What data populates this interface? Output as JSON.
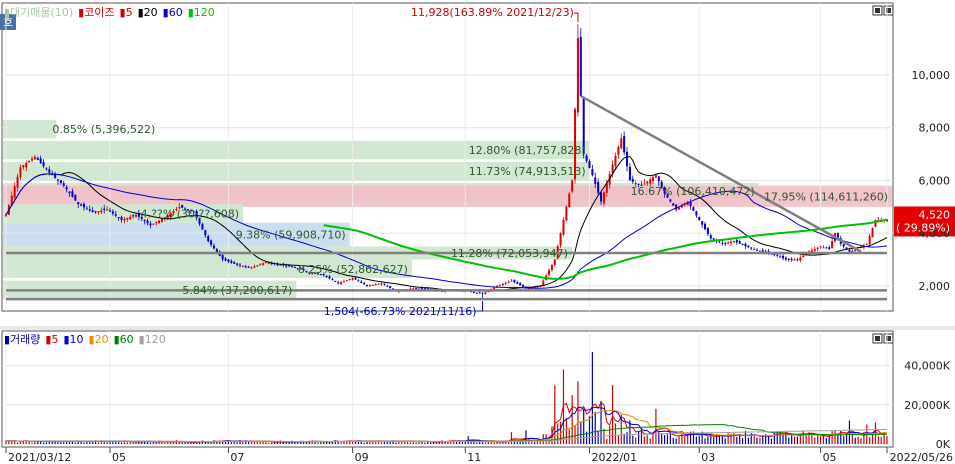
{
  "price_panel": {
    "legend": [
      {
        "text": "▮대기매물(10)",
        "color": "#a8c8a8"
      },
      {
        "text": "▮코이즈",
        "color": "#d40000"
      },
      {
        "text": "▮5",
        "color": "#d40000"
      },
      {
        "text": "▮20",
        "color": "#000000"
      },
      {
        "text": "▮60",
        "color": "#0000c8"
      },
      {
        "text": "▮120",
        "color": "#00c000"
      }
    ],
    "corner_tab": "호",
    "ylim": [
      1200,
      12200
    ],
    "y_ticks": [
      {
        "value": 2000,
        "label": "2,000"
      },
      {
        "value": 4000,
        "label": "4,000"
      },
      {
        "value": 6000,
        "label": "6,000"
      },
      {
        "value": 8000,
        "label": "8,000"
      },
      {
        "value": 10000,
        "label": "10,000"
      }
    ],
    "supply_bands": [
      {
        "low": 7600,
        "high": 8300,
        "width_frac": 0.06,
        "color": "#cfe6cf",
        "label": "0.85% (5,396,522)"
      },
      {
        "low": 6800,
        "high": 7500,
        "width_frac": 0.66,
        "color": "#cfe6cf",
        "label": "12.80% (81,757,828)"
      },
      {
        "low": 6000,
        "high": 6700,
        "width_frac": 0.66,
        "color": "#cfe6cf",
        "label": "11.73% (74,913,513)"
      },
      {
        "low": 5300,
        "high": 5900,
        "width_frac": 0.85,
        "color": "#cfe6cf",
        "label": "16.67% (106,410,472)"
      },
      {
        "low": 5000,
        "high": 5800,
        "width_frac": 1.0,
        "color": "#f0c0c8",
        "label": "17.95% (114,611,260)"
      },
      {
        "low": 4400,
        "high": 5100,
        "width_frac": 0.27,
        "color": "#cfe6cf",
        "label": "4.??% (30,??,608)"
      },
      {
        "low": 3500,
        "high": 4400,
        "width_frac": 0.39,
        "color": "#c8dcee",
        "label": "9.38% (59,908,710)"
      },
      {
        "low": 3000,
        "high": 3500,
        "width_frac": 0.64,
        "color": "#cfe6cf",
        "label": "11.28% (72,053,947)"
      },
      {
        "low": 2300,
        "high": 3000,
        "width_frac": 0.46,
        "color": "#cfe6cf",
        "label": "8.25% (52,862,627)"
      },
      {
        "low": 1500,
        "high": 2200,
        "width_frac": 0.33,
        "color": "#cfe6cf",
        "label": "5.84% (37,200,617)"
      }
    ],
    "current_price": {
      "label": "4,520",
      "change": "( 29.89%)",
      "value": 4520
    },
    "high_annotation": "11,928(163.89% 2021/12/23)",
    "low_annotation": "1,504(-66.73% 2021/11/16)"
  },
  "volume_panel": {
    "legend": [
      {
        "text": "▮거래량",
        "color": "#0000a0"
      },
      {
        "text": "▮5",
        "color": "#d40000"
      },
      {
        "text": "▮10",
        "color": "#0000c8"
      },
      {
        "text": "▮20",
        "color": "#e09000"
      },
      {
        "text": "▮60",
        "color": "#008000"
      },
      {
        "text": "▮120",
        "color": "#a0a0a0"
      }
    ],
    "ylim": [
      0,
      50000
    ],
    "y_ticks": [
      {
        "value": 0,
        "label": "0K"
      },
      {
        "value": 20000,
        "label": "20,000K"
      },
      {
        "value": 40000,
        "label": "40,000K"
      }
    ]
  },
  "x_axis": {
    "labels": [
      {
        "idx": 0,
        "label": "2021/03/12"
      },
      {
        "idx": 36,
        "label": "05"
      },
      {
        "idx": 77,
        "label": "07"
      },
      {
        "idx": 120,
        "label": "09"
      },
      {
        "idx": 159,
        "label": "11"
      },
      {
        "idx": 202,
        "label": "2022/01"
      },
      {
        "idx": 240,
        "label": "03"
      },
      {
        "idx": 282,
        "label": "05"
      },
      {
        "idx": 305,
        "label": "2022/05/26"
      }
    ]
  },
  "chart_data": {
    "type": "candlestick",
    "title": "",
    "series_names": [
      "코이즈",
      "5",
      "20",
      "60",
      "120"
    ],
    "x_range": [
      "2021/03/12",
      "2022/05/26"
    ],
    "anchors": [
      [
        0,
        4700
      ],
      [
        5,
        6500
      ],
      [
        10,
        6900
      ],
      [
        15,
        6300
      ],
      [
        20,
        5800
      ],
      [
        25,
        5100
      ],
      [
        30,
        4800
      ],
      [
        35,
        4900
      ],
      [
        40,
        4500
      ],
      [
        45,
        4700
      ],
      [
        50,
        4300
      ],
      [
        55,
        4600
      ],
      [
        60,
        5000
      ],
      [
        65,
        4800
      ],
      [
        70,
        3700
      ],
      [
        75,
        3000
      ],
      [
        80,
        2800
      ],
      [
        85,
        2700
      ],
      [
        90,
        2900
      ],
      [
        95,
        2800
      ],
      [
        100,
        2700
      ],
      [
        105,
        2500
      ],
      [
        110,
        2400
      ],
      [
        115,
        2100
      ],
      [
        120,
        2300
      ],
      [
        125,
        2000
      ],
      [
        130,
        2100
      ],
      [
        135,
        1800
      ],
      [
        140,
        1900
      ],
      [
        145,
        1900
      ],
      [
        150,
        1800
      ],
      [
        155,
        1850
      ],
      [
        160,
        1800
      ],
      [
        165,
        1700
      ],
      [
        170,
        2000
      ],
      [
        175,
        2200
      ],
      [
        180,
        1900
      ],
      [
        185,
        2000
      ],
      [
        190,
        3000
      ],
      [
        193,
        4500
      ],
      [
        196,
        6000
      ],
      [
        198,
        11400
      ],
      [
        200,
        7000
      ],
      [
        203,
        6200
      ],
      [
        206,
        5200
      ],
      [
        210,
        6600
      ],
      [
        213,
        7600
      ],
      [
        216,
        6000
      ],
      [
        220,
        5800
      ],
      [
        225,
        6200
      ],
      [
        228,
        5500
      ],
      [
        232,
        4900
      ],
      [
        236,
        5200
      ],
      [
        240,
        4500
      ],
      [
        244,
        3800
      ],
      [
        248,
        3600
      ],
      [
        252,
        3700
      ],
      [
        256,
        3500
      ],
      [
        262,
        3300
      ],
      [
        266,
        3200
      ],
      [
        270,
        3000
      ],
      [
        274,
        3000
      ],
      [
        278,
        3300
      ],
      [
        282,
        3500
      ],
      [
        285,
        3400
      ],
      [
        287,
        4000
      ],
      [
        289,
        3600
      ],
      [
        292,
        3300
      ],
      [
        295,
        3400
      ],
      [
        298,
        3600
      ],
      [
        301,
        4500
      ],
      [
        305,
        4520
      ]
    ],
    "volume_spikes": [
      [
        160,
        4000
      ],
      [
        175,
        6000
      ],
      [
        180,
        7000
      ],
      [
        186,
        5000
      ],
      [
        190,
        30000
      ],
      [
        193,
        38000
      ],
      [
        196,
        25000
      ],
      [
        198,
        32000
      ],
      [
        200,
        18000
      ],
      [
        203,
        47000
      ],
      [
        206,
        22000
      ],
      [
        210,
        30000
      ],
      [
        213,
        15000
      ],
      [
        216,
        12000
      ],
      [
        220,
        8000
      ],
      [
        225,
        18000
      ],
      [
        230,
        6000
      ],
      [
        240,
        4000
      ],
      [
        255,
        3000
      ],
      [
        270,
        6000
      ],
      [
        282,
        4000
      ],
      [
        292,
        12000
      ],
      [
        298,
        10000
      ],
      [
        301,
        11000
      ]
    ],
    "trendlines": [
      {
        "color": "#808080",
        "width": 2.5,
        "p1": [
          199,
          9200
        ],
        "p2": [
          296,
          3300
        ]
      },
      {
        "color": "#808080",
        "width": 2.5,
        "p1": [
          0,
          3250
        ],
        "p2": [
          305,
          3250
        ]
      },
      {
        "color": "#808080",
        "width": 2.5,
        "p1": [
          0,
          1830
        ],
        "p2": [
          305,
          1830
        ]
      },
      {
        "color": "#808080",
        "width": 2.5,
        "p1": [
          0,
          1500
        ],
        "p2": [
          305,
          1500
        ]
      }
    ]
  }
}
